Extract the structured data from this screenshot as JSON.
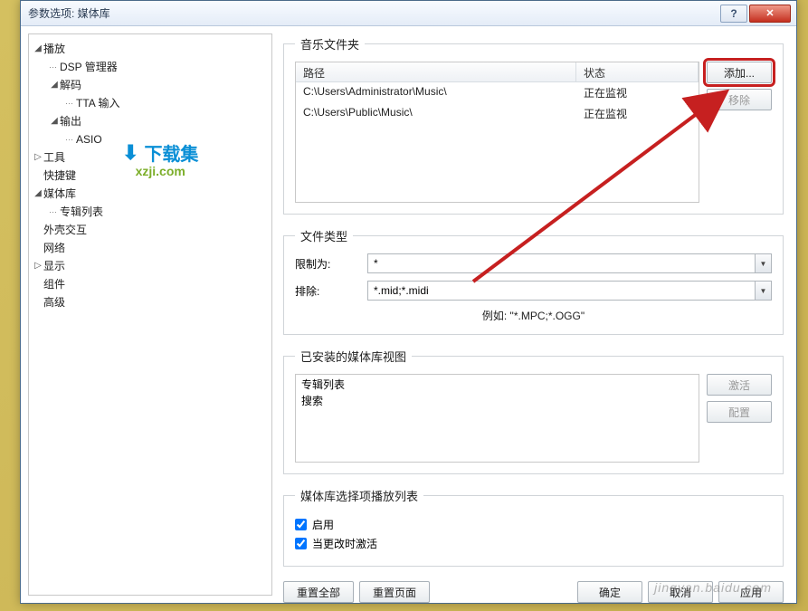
{
  "window": {
    "title": "参数选项: 媒体库"
  },
  "tree": {
    "播放": "播放",
    "DSP管理器": "DSP 管理器",
    "解码": "解码",
    "TTA输入": "TTA 输入",
    "输出": "输出",
    "ASIO": "ASIO",
    "工具": "工具",
    "快捷键": "快捷键",
    "媒体库": "媒体库",
    "专辑列表": "专辑列表",
    "外壳交互": "外壳交互",
    "网络": "网络",
    "显示": "显示",
    "组件": "组件",
    "高级": "高级"
  },
  "music_folders": {
    "legend": "音乐文件夹",
    "headers": {
      "path": "路径",
      "state": "状态"
    },
    "rows": [
      {
        "path": "C:\\Users\\Administrator\\Music\\",
        "state": "正在监视"
      },
      {
        "path": "C:\\Users\\Public\\Music\\",
        "state": "正在监视"
      }
    ],
    "add": "添加...",
    "remove": "移除"
  },
  "file_types": {
    "legend": "文件类型",
    "limit_label": "限制为:",
    "limit_value": "*",
    "exclude_label": "排除:",
    "exclude_value": "*.mid;*.midi",
    "example": "例如: \"*.MPC;*.OGG\""
  },
  "views": {
    "legend": "已安装的媒体库视图",
    "items": [
      "专辑列表",
      "搜索"
    ],
    "activate": "激活",
    "configure": "配置"
  },
  "playlist": {
    "legend": "媒体库选择项播放列表",
    "enable": "启用",
    "activate_on_change": "当更改时激活"
  },
  "buttons": {
    "reset_all": "重置全部",
    "reset_page": "重置页面",
    "ok": "确定",
    "cancel": "取消",
    "apply": "应用"
  },
  "logo": {
    "text": "下载集",
    "url": "xzji.com"
  },
  "watermark": "jingyan.baidu.com"
}
